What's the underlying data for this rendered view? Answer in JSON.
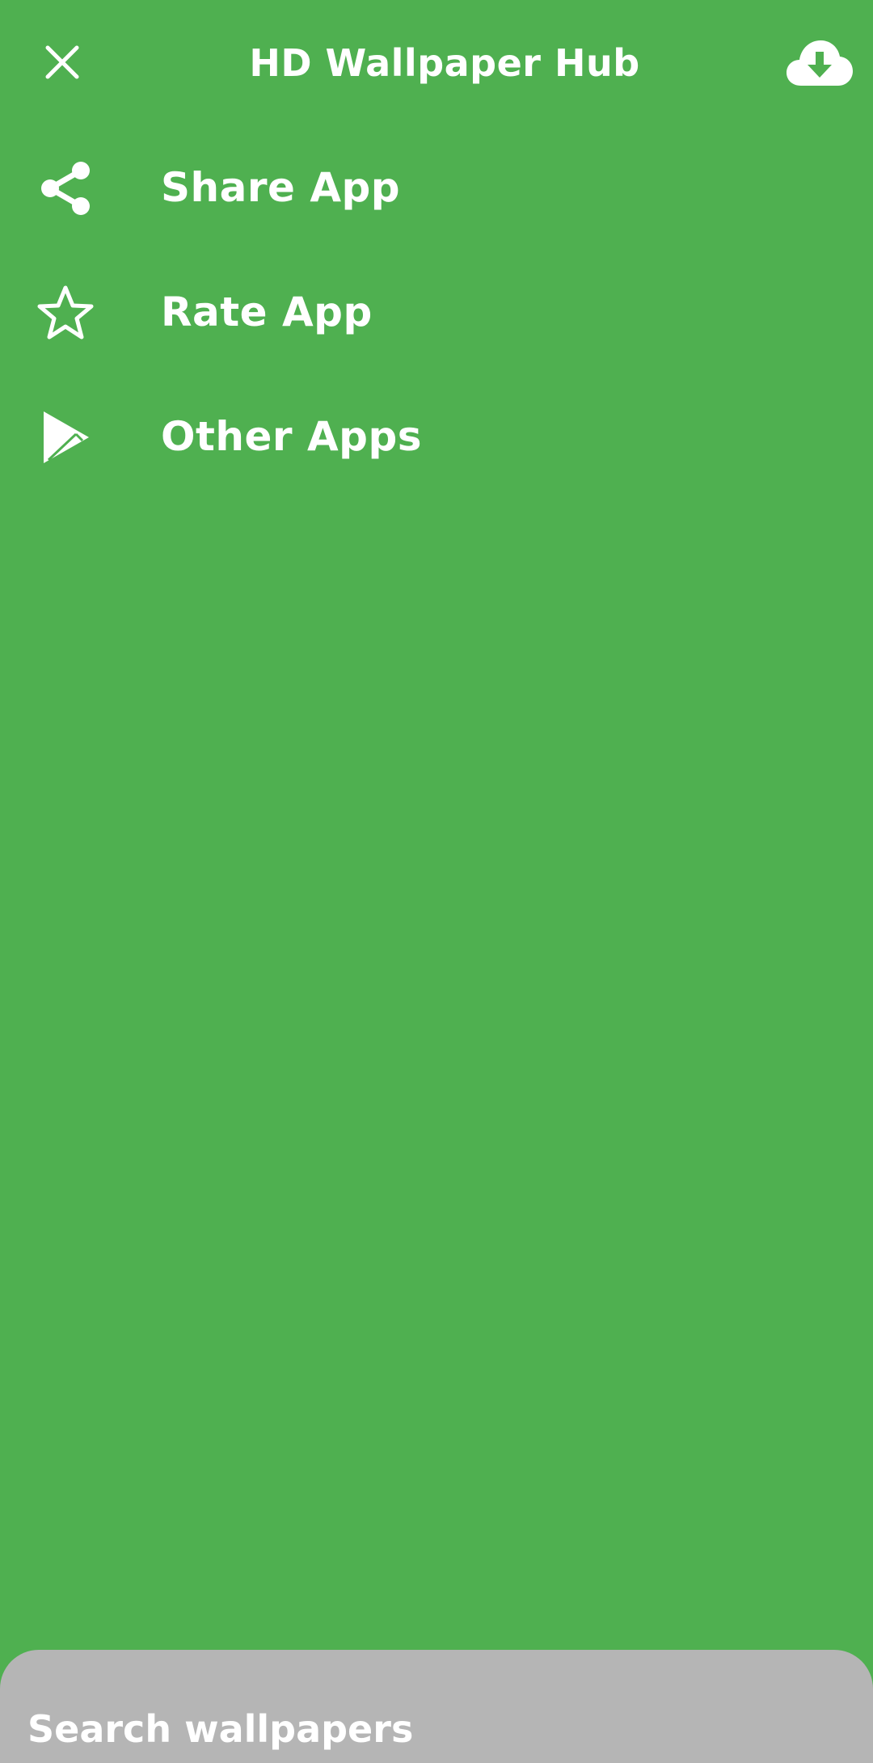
{
  "header": {
    "title": "HD Wallpaper Hub",
    "close_icon": "close-icon",
    "download_icon": "cloud-download-icon"
  },
  "menu": {
    "items": [
      {
        "label": "Share App",
        "icon": "share-icon"
      },
      {
        "label": "Rate App",
        "icon": "star-outline-icon"
      },
      {
        "label": "Other Apps",
        "icon": "play-store-icon"
      }
    ]
  },
  "search": {
    "placeholder": "Search wallpapers"
  },
  "colors": {
    "background": "#4fb050",
    "search_bar": "#b5b5b5",
    "foreground": "#ffffff"
  }
}
